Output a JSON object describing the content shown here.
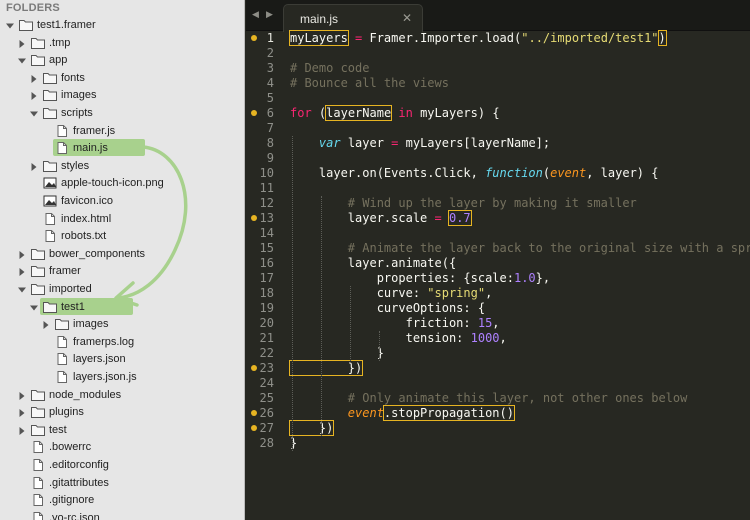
{
  "sidebar": {
    "header": "FOLDERS",
    "items": [
      {
        "label": "test1.framer",
        "depth": 0,
        "type": "folder",
        "open": true
      },
      {
        "label": ".tmp",
        "depth": 1,
        "type": "folder",
        "open": false
      },
      {
        "label": "app",
        "depth": 1,
        "type": "folder",
        "open": true
      },
      {
        "label": "fonts",
        "depth": 2,
        "type": "folder",
        "open": false
      },
      {
        "label": "images",
        "depth": 2,
        "type": "folder",
        "open": false
      },
      {
        "label": "scripts",
        "depth": 2,
        "type": "folder",
        "open": true
      },
      {
        "label": "framer.js",
        "depth": 3,
        "type": "file"
      },
      {
        "label": "main.js",
        "depth": 3,
        "type": "file",
        "highlight": true
      },
      {
        "label": "styles",
        "depth": 2,
        "type": "folder",
        "open": false
      },
      {
        "label": "apple-touch-icon.png",
        "depth": 2,
        "type": "image"
      },
      {
        "label": "favicon.ico",
        "depth": 2,
        "type": "image"
      },
      {
        "label": "index.html",
        "depth": 2,
        "type": "file"
      },
      {
        "label": "robots.txt",
        "depth": 2,
        "type": "file"
      },
      {
        "label": "bower_components",
        "depth": 1,
        "type": "folder",
        "open": false
      },
      {
        "label": "framer",
        "depth": 1,
        "type": "folder",
        "open": false
      },
      {
        "label": "imported",
        "depth": 1,
        "type": "folder",
        "open": true
      },
      {
        "label": "test1",
        "depth": 2,
        "type": "folder",
        "open": true,
        "highlight": true
      },
      {
        "label": "images",
        "depth": 3,
        "type": "folder",
        "open": false
      },
      {
        "label": "framerps.log",
        "depth": 3,
        "type": "file"
      },
      {
        "label": "layers.json",
        "depth": 3,
        "type": "file"
      },
      {
        "label": "layers.json.js",
        "depth": 3,
        "type": "file"
      },
      {
        "label": "node_modules",
        "depth": 1,
        "type": "folder",
        "open": false
      },
      {
        "label": "plugins",
        "depth": 1,
        "type": "folder",
        "open": false
      },
      {
        "label": "test",
        "depth": 1,
        "type": "folder",
        "open": false
      },
      {
        "label": ".bowerrc",
        "depth": 1,
        "type": "file"
      },
      {
        "label": ".editorconfig",
        "depth": 1,
        "type": "file"
      },
      {
        "label": ".gitattributes",
        "depth": 1,
        "type": "file"
      },
      {
        "label": ".gitignore",
        "depth": 1,
        "type": "file"
      },
      {
        "label": ".yo-rc.json",
        "depth": 1,
        "type": "file"
      }
    ]
  },
  "editor": {
    "nav_left": "◀",
    "nav_right": "▶",
    "tab_title": "main.js",
    "tab_close": "✕",
    "current_line": 1,
    "lines": [
      {
        "n": "1",
        "dot": true,
        "tokens": [
          [
            "myLayers",
            "plain",
            true
          ],
          [
            " = ",
            "op"
          ],
          [
            "Framer",
            "plain"
          ],
          [
            ".",
            "punc"
          ],
          [
            "Importer",
            "plain"
          ],
          [
            ".",
            "punc"
          ],
          [
            "load",
            "plain"
          ],
          [
            "(",
            "punc"
          ],
          [
            "\"../imported/test1\"",
            "str"
          ],
          [
            ")",
            "punc",
            true
          ]
        ]
      },
      {
        "n": "2",
        "tokens": []
      },
      {
        "n": "3",
        "tokens": [
          [
            "# Demo code",
            "cmt"
          ]
        ]
      },
      {
        "n": "4",
        "tokens": [
          [
            "# Bounce all the views",
            "cmt"
          ]
        ]
      },
      {
        "n": "5",
        "tokens": []
      },
      {
        "n": "6",
        "dot": true,
        "tokens": [
          [
            "for",
            "kw"
          ],
          [
            " (",
            "punc"
          ],
          [
            "layerName",
            "plain",
            true
          ],
          [
            " in ",
            "kw"
          ],
          [
            "myLayers",
            "plain"
          ],
          [
            ") {",
            "punc"
          ]
        ]
      },
      {
        "n": "7",
        "tokens": []
      },
      {
        "n": "8",
        "tokens": [
          [
            "    ",
            "plain"
          ],
          [
            "var",
            "storage"
          ],
          [
            " layer ",
            "plain"
          ],
          [
            "=",
            "op"
          ],
          [
            " myLayers[layerName];",
            "plain"
          ]
        ]
      },
      {
        "n": "9",
        "tokens": []
      },
      {
        "n": "10",
        "tokens": [
          [
            "    layer.on(Events.Click, ",
            "plain"
          ],
          [
            "function",
            "storage"
          ],
          [
            "(",
            "punc"
          ],
          [
            "event",
            "param"
          ],
          [
            ", layer) {",
            "punc"
          ]
        ]
      },
      {
        "n": "11",
        "tokens": []
      },
      {
        "n": "12",
        "tokens": [
          [
            "        ",
            "plain"
          ],
          [
            "# Wind up the layer by making it smaller",
            "cmt"
          ]
        ]
      },
      {
        "n": "13",
        "dot": true,
        "tokens": [
          [
            "        layer.scale ",
            "plain"
          ],
          [
            "=",
            "op"
          ],
          [
            " ",
            "plain"
          ],
          [
            "0.7",
            "num",
            true
          ]
        ]
      },
      {
        "n": "14",
        "tokens": []
      },
      {
        "n": "15",
        "tokens": [
          [
            "        ",
            "plain"
          ],
          [
            "# Animate the layer back to the original size with a spring",
            "cmt"
          ]
        ]
      },
      {
        "n": "16",
        "tokens": [
          [
            "        layer.animate({",
            "plain"
          ]
        ]
      },
      {
        "n": "17",
        "tokens": [
          [
            "            properties: {scale:",
            "plain"
          ],
          [
            "1.0",
            "num"
          ],
          [
            "},",
            "plain"
          ]
        ]
      },
      {
        "n": "18",
        "tokens": [
          [
            "            curve: ",
            "plain"
          ],
          [
            "\"spring\"",
            "str"
          ],
          [
            ",",
            "plain"
          ]
        ]
      },
      {
        "n": "19",
        "tokens": [
          [
            "            curveOptions: {",
            "plain"
          ]
        ]
      },
      {
        "n": "20",
        "tokens": [
          [
            "                friction: ",
            "plain"
          ],
          [
            "15",
            "num"
          ],
          [
            ",",
            "plain"
          ]
        ]
      },
      {
        "n": "21",
        "tokens": [
          [
            "                tension: ",
            "plain"
          ],
          [
            "1000",
            "num"
          ],
          [
            ",",
            "plain"
          ]
        ]
      },
      {
        "n": "22",
        "tokens": [
          [
            "            }",
            "plain"
          ]
        ]
      },
      {
        "n": "23",
        "dot": true,
        "tokens": [
          [
            "        })",
            "plain",
            true
          ]
        ]
      },
      {
        "n": "24",
        "tokens": []
      },
      {
        "n": "25",
        "tokens": [
          [
            "        ",
            "plain"
          ],
          [
            "# Only animate this layer, not other ones below",
            "cmt"
          ]
        ]
      },
      {
        "n": "26",
        "dot": true,
        "tokens": [
          [
            "        ",
            "plain"
          ],
          [
            "event",
            "param"
          ],
          [
            ".stopPropagation()",
            "plain",
            true
          ]
        ]
      },
      {
        "n": "27",
        "dot": true,
        "tokens": [
          [
            "    })",
            "plain",
            true
          ]
        ]
      },
      {
        "n": "28",
        "tokens": [
          [
            "}",
            "plain"
          ]
        ]
      }
    ]
  },
  "colors": {
    "sidebar_bg": "#e6e6e6",
    "highlight_green": "#a8d18d",
    "editor_bg": "#272822",
    "keyword": "#f92672",
    "string": "#e6db74",
    "number": "#ae81ff",
    "comment": "#75715e",
    "storage": "#66d9ef",
    "param": "#fd971f",
    "annotation_arrow": "#a8d18d"
  }
}
